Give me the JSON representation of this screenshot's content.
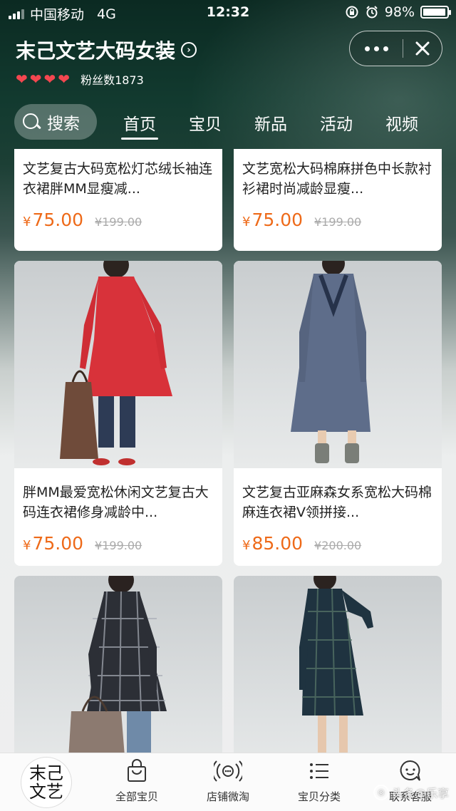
{
  "status_bar": {
    "carrier": "中国移动",
    "network": "4G",
    "time": "12:32",
    "battery_percent": "98%",
    "battery_level": 0.98
  },
  "header": {
    "shop_name": "末己文艺大码女装",
    "fans_label": "粉丝数1873",
    "hearts": 4,
    "heart_color": "#f44750"
  },
  "nav": {
    "search_label": "搜索",
    "tabs": [
      "首页",
      "宝贝",
      "新品",
      "活动",
      "视频"
    ],
    "active_tab": "首页"
  },
  "products": [
    {
      "name": "文艺复古大码宽松灯芯绒长袖连衣裙胖MM显瘦减...",
      "price": "75.00",
      "original_price": "¥199.00",
      "currency": "¥"
    },
    {
      "name": "文艺宽松大码棉麻拼色中长款衬衫裙时尚减龄显瘦...",
      "price": "75.00",
      "original_price": "¥199.00",
      "currency": "¥"
    },
    {
      "name": "胖MM最爱宽松休闲文艺复古大码连衣裙修身减龄中...",
      "price": "75.00",
      "original_price": "¥199.00",
      "currency": "¥"
    },
    {
      "name": "文艺复古亚麻森女系宽松大码棉麻连衣裙V领拼接...",
      "price": "85.00",
      "original_price": "¥200.00",
      "currency": "¥"
    },
    {
      "name": "",
      "price": "",
      "original_price": "",
      "currency": ""
    },
    {
      "name": "",
      "price": "",
      "original_price": "",
      "currency": ""
    }
  ],
  "tab_bar": {
    "logo_text": "末己文艺",
    "items": [
      {
        "label": "全部宝贝",
        "icon": "shopping-bag-icon"
      },
      {
        "label": "店铺微淘",
        "icon": "broadcast-icon"
      },
      {
        "label": "宝贝分类",
        "icon": "category-list-icon"
      },
      {
        "label": "联系客服",
        "icon": "customer-service-icon"
      }
    ]
  },
  "watermark": "头条@乐享"
}
